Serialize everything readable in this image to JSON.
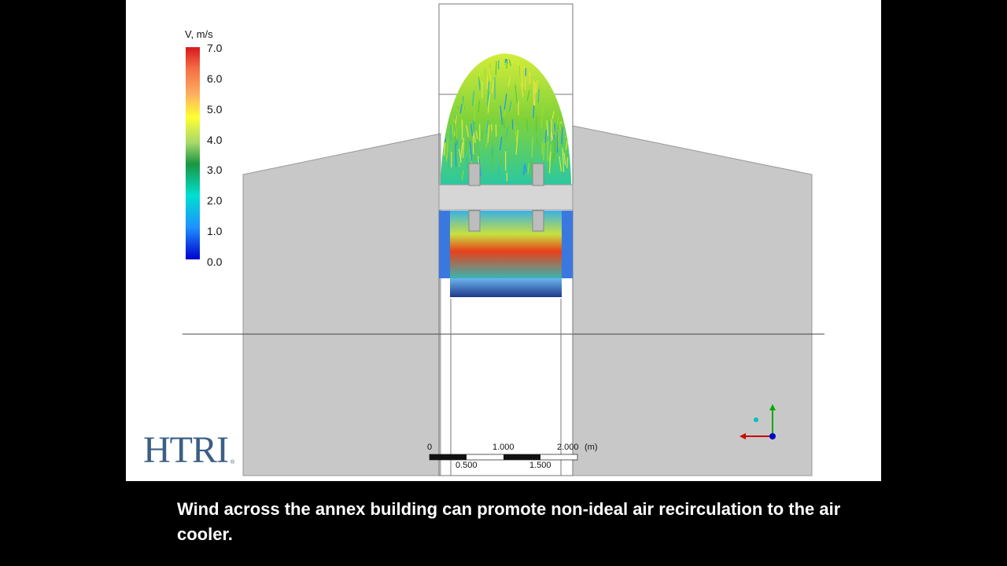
{
  "legend": {
    "title": "V, m/s",
    "ticks": [
      "7.0",
      "6.0",
      "5.0",
      "4.0",
      "3.0",
      "2.0",
      "1.0",
      "0.0"
    ],
    "colormap": [
      "#d7191c",
      "#fdae61",
      "#ffff33",
      "#1a9641",
      "#00e0d0",
      "#1e90ff",
      "#0000cc"
    ]
  },
  "logo": {
    "text": "HTRI",
    "reg": "®"
  },
  "scale_bar": {
    "top_labels": [
      "0",
      "1.000",
      "2.000"
    ],
    "unit": "(m)",
    "bottom_labels": [
      "0.500",
      "1.500"
    ]
  },
  "caption": "Wind across the annex building can promote non-ideal air recirculation to the air cooler.",
  "colors": {
    "building": "#c8c8c8",
    "axis_x": "#cc0000",
    "axis_y": "#00aa00",
    "axis_z": "#0000cc"
  }
}
